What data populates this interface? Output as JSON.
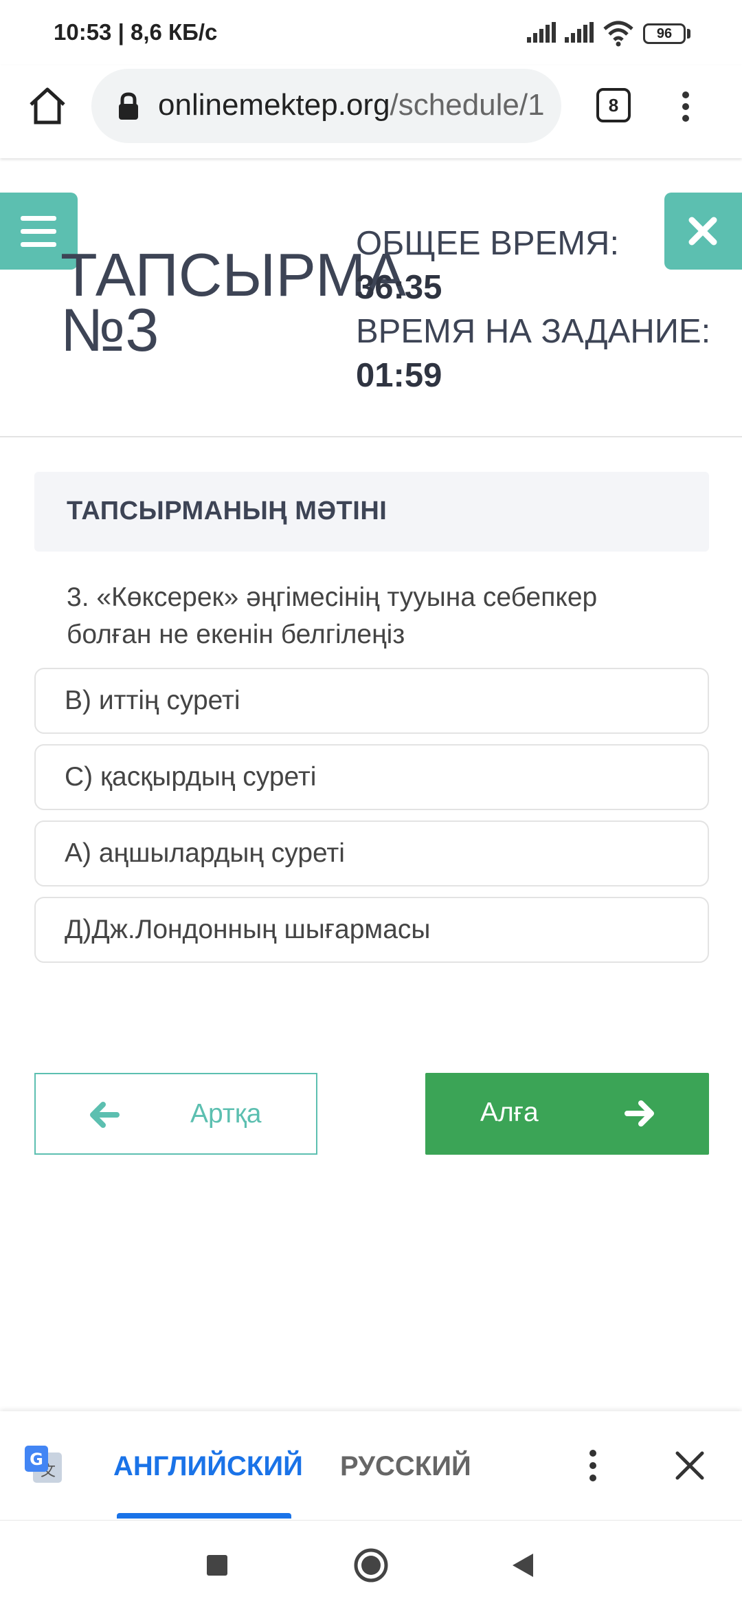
{
  "status_bar": {
    "time": "10:53",
    "net_speed": "8,6 КБ/с",
    "battery": "96"
  },
  "browser": {
    "url_domain": "onlinemektep.org",
    "url_path": "/schedule/1",
    "tab_count": "8",
    "icons": [
      "home-icon",
      "lock-icon",
      "tabs-icon",
      "kebab-menu-icon"
    ]
  },
  "header": {
    "task_title": "ТАПСЫРМА №3",
    "total_time_label": "ОБЩЕЕ ВРЕМЯ:",
    "total_time_value": "36:35",
    "task_time_label": "ВРЕМЯ НА ЗАДАНИЕ:",
    "task_time_value": "01:59",
    "accent_color": "#5cbfb0"
  },
  "question": {
    "heading": "ТАПСЫРМАНЫҢ МӘТІНІ",
    "text": "3. «Көксерек» әңгімесінің тууына себепкер болған не екенін белгілеңіз",
    "options": [
      "В) иттің суреті",
      "С) қасқырдың суреті",
      "А) аңшылардың суреті",
      "Д)Дж.Лондонның шығармасы"
    ]
  },
  "navigation": {
    "back_label": "Артқа",
    "next_label": "Алға",
    "next_color": "#3ba456"
  },
  "translate_bar": {
    "lang_active": "АНГЛИЙСКИЙ",
    "lang_other": "РУССКИЙ",
    "active_color": "#1a73e8"
  }
}
